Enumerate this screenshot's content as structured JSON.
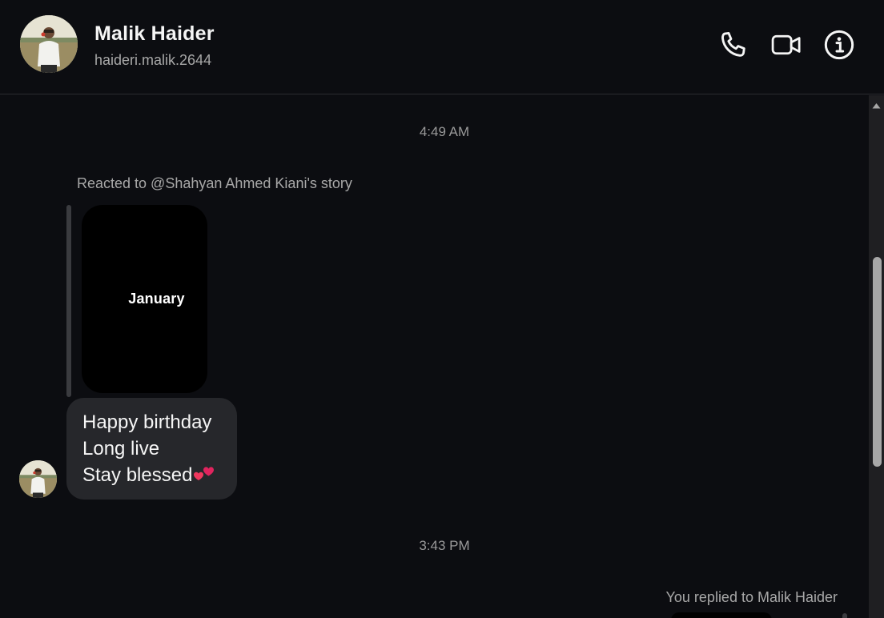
{
  "header": {
    "name": "Malik Haider",
    "handle": "haideri.malik.2644",
    "avatar_icon": "person-photo-avatar",
    "call_icon": "phone-icon",
    "video_icon": "video-camera-icon",
    "info_icon": "info-icon"
  },
  "conversation": {
    "timestamp_1": "4:49 AM",
    "reaction_label": "Reacted to @Shahyan Ahmed Kiani's story",
    "story_text": "January",
    "message_lines": [
      "Happy birthday",
      "Long live",
      "Stay blessed"
    ],
    "message_emoji": "two-hearts-emoji",
    "timestamp_2": "3:43 PM",
    "reply_label": "You replied to Malik Haider"
  },
  "colors": {
    "background": "#0c0d11",
    "bubble": "#26272b",
    "muted_text": "#a8a8a8",
    "heart": "#e0245e"
  }
}
